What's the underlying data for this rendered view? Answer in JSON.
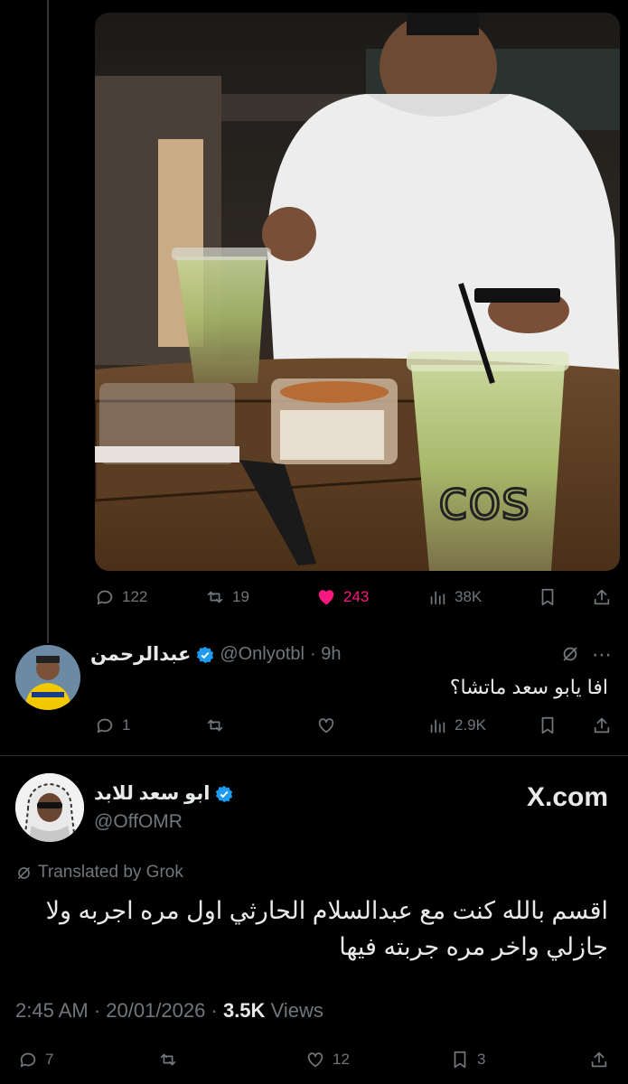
{
  "main_tweet": {
    "stats": {
      "replies": "122",
      "reposts": "19",
      "likes": "243",
      "views": "38K"
    }
  },
  "reply": {
    "name": "عبدالرحمن",
    "handle": "@Onlyotbl",
    "time": "· 9h",
    "text": "افا يابو سعد ماتشا؟",
    "stats": {
      "replies": "1",
      "reposts": "",
      "likes": "",
      "views": "2.9K"
    }
  },
  "quoted_tweet": {
    "name": "ابو سعد للابد",
    "handle": "@OffOMR",
    "watermark": "X.com",
    "translated_label": "Translated by Grok",
    "text": "اقسم بالله كنت مع عبدالسلام الحارثي اول مره اجربه ولا جازلي واخر مره جربته فيها",
    "timestamp": "2:45 AM · 20/01/2026 ·",
    "views_count": "3.5K",
    "views_label": "Views",
    "stats": {
      "replies": "7",
      "reposts": "",
      "likes": "12",
      "bookmarks": "3"
    }
  },
  "colors": {
    "background": "#000000",
    "muted": "#71767b",
    "like": "#f91880",
    "verified": "#1d9bf0"
  }
}
